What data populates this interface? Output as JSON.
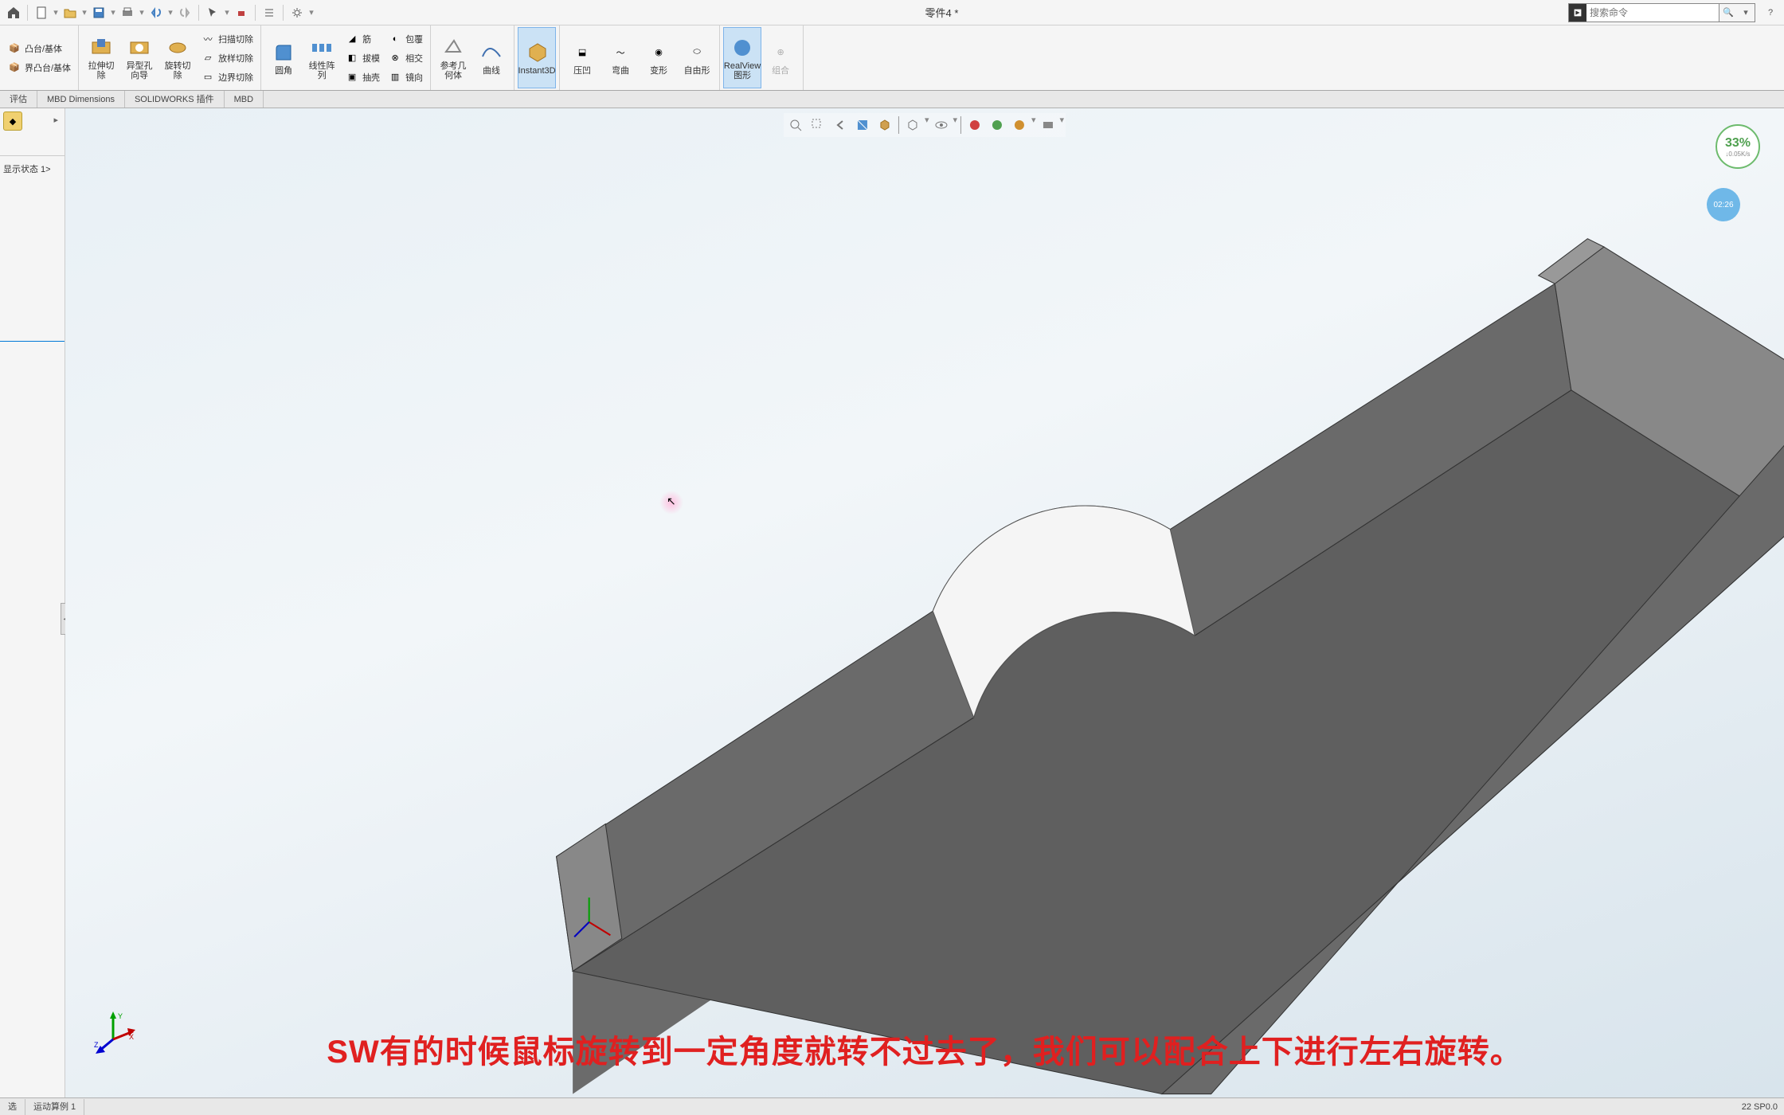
{
  "title": "零件4 *",
  "search": {
    "placeholder": "搜索命令"
  },
  "qat": {
    "home": "home",
    "new": "new",
    "open": "open",
    "save": "save",
    "print": "print",
    "undo": "undo",
    "redo": "redo",
    "select": "select",
    "rebuild": "rebuild",
    "options": "options",
    "settings": "settings"
  },
  "ribbon": {
    "g1": {
      "a": "凸台/基体",
      "b": "界凸台/基体"
    },
    "g2": {
      "a": "拉伸切除",
      "b": "异型孔向导",
      "c": "旋转切除",
      "s1": "扫描切除",
      "s2": "放样切除",
      "s3": "边界切除"
    },
    "g3": {
      "a": "圆角",
      "b": "线性阵列",
      "s1": "筋",
      "s2": "拔模",
      "s3": "抽壳",
      "t1": "包覆",
      "t2": "相交",
      "t3": "镜向"
    },
    "g4": {
      "a": "参考几何体",
      "b": "曲线"
    },
    "g5": {
      "a": "Instant3D"
    },
    "g6": {
      "a": "压凹",
      "b": "弯曲",
      "c": "变形",
      "d": "自由形"
    },
    "g7": {
      "a": "RealView 图形",
      "b": "组合"
    }
  },
  "cmdtabs": [
    "评估",
    "MBD Dimensions",
    "SOLIDWORKS 插件",
    "MBD"
  ],
  "tree": {
    "state_label": "显示状态 1>"
  },
  "perf": {
    "pct": "33%",
    "speed": "↓0.05K/s"
  },
  "time_badge": "02:26",
  "status": {
    "tabs": [
      "选",
      "运动算例 1"
    ],
    "version": "22 SP0.0"
  },
  "subtitle": "SW有的时候鼠标旋转到一定角度就转不过去了，我们可以配合上下进行左右旋转。",
  "hud_icons": [
    "zoom-fit",
    "zoom-area",
    "prev-view",
    "section",
    "display-style",
    "hide-show",
    "edit-appearance",
    "scene",
    "view-settings",
    "render",
    "camera",
    "light",
    "display"
  ]
}
